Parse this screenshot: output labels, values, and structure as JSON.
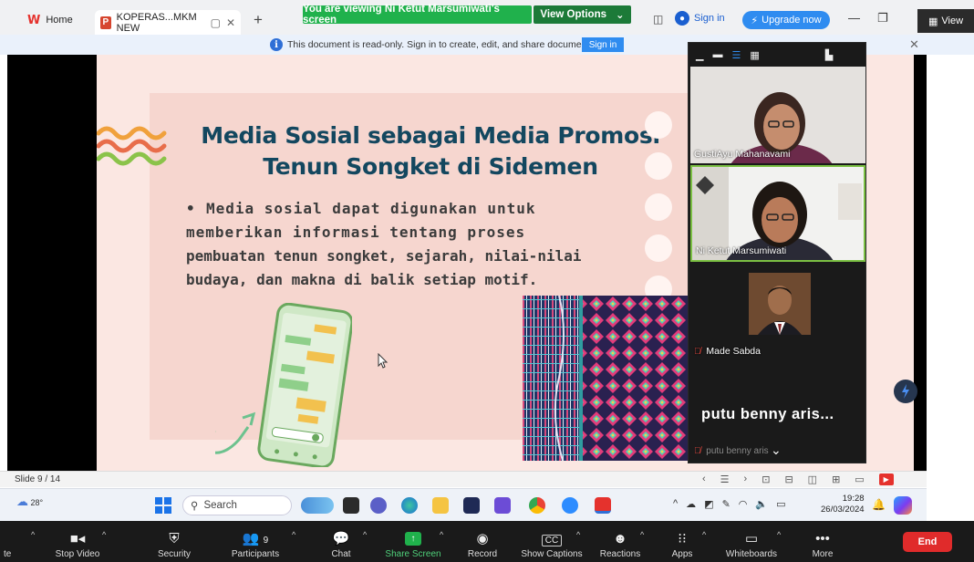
{
  "browser": {
    "home_tab": "Home",
    "doc_tab": "KOPERAS...MKM NEW",
    "share_banner": "You are viewing Ni Ketut Marsumiwati's screen",
    "view_options": "View Options",
    "sign_in": "Sign in",
    "upgrade": "Upgrade now",
    "view_label": "View"
  },
  "infobar": {
    "message": "This document is read-only. Sign in to create, edit, and share documents.",
    "sign_in": "Sign in"
  },
  "slide": {
    "title_line1": "Media Sosial sebagai Media Promosi",
    "title_line2": "Tenun Songket di Sidemen",
    "body_line1": "Media sosial dapat digunakan untuk",
    "body_line2": "memberikan informasi tentang proses",
    "body_line3": "pembuatan tenun songket, sejarah, nilai-nilai",
    "body_line4": "budaya, dan makna di balik setiap motif."
  },
  "gallery": {
    "participants": [
      {
        "name": "GustiAyu Mahanavami"
      },
      {
        "name": "Ni Ketut Marsumiwati"
      },
      {
        "name": "Made Sabda"
      },
      {
        "name": "putu benny aris..."
      }
    ],
    "benny_small": "putu benny aris"
  },
  "statusbar": {
    "slide_num": "Slide 9 / 14"
  },
  "taskbar": {
    "temperature": "28°",
    "search": "Search",
    "time": "19:28",
    "date": "26/03/2024"
  },
  "zoombar": {
    "items": {
      "stop_video": "Stop Video",
      "security": "Security",
      "participants": "Participants",
      "participants_count": "9",
      "chat": "Chat",
      "share_screen": "Share Screen",
      "record": "Record",
      "show_captions": "Show Captions",
      "reactions": "Reactions",
      "apps": "Apps",
      "whiteboards": "Whiteboards",
      "more": "More",
      "end": "End",
      "te": "te"
    }
  },
  "colors": {
    "share_green": "#20b14c",
    "slide_title": "#13475f",
    "slide_bg": "#fbe7e2",
    "end_red": "#e02b2b"
  }
}
